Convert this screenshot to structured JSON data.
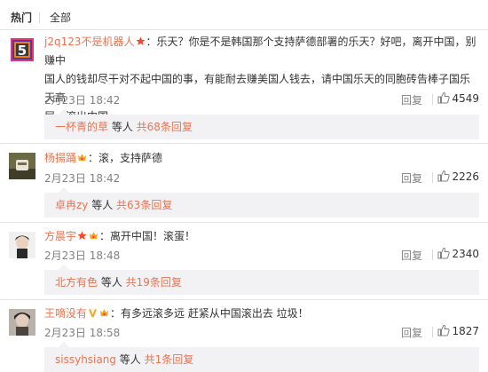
{
  "tabs": {
    "hot": "热门",
    "all": "全部"
  },
  "colors": {
    "username": "#eb7350",
    "text": "#333333",
    "meta": "#808080",
    "sub_bg": "#f2f2f5"
  },
  "comments": [
    {
      "user": "j2q123不是机器人",
      "badges": [
        "star-badge"
      ],
      "text_line1": "：乐天？你是不是韩国那个支持萨德部署的乐天？好吧，离开中国，别赚中",
      "text_line2": "国人的钱却尽干对不起中国的事，有能耐去赚美国人钱去，请中国乐天的同胞砖告棒子国乐天高",
      "text_line3": "层，滚出中国",
      "time": "2月23日 18:42",
      "reply": "回复",
      "likes": "4549",
      "sub_user": "一杯青的草",
      "sub_mid": " 等人 ",
      "sub_count": "共68条回复",
      "avatar_text": "5"
    },
    {
      "user": "杨揚踊",
      "badges": [
        "vip-badge"
      ],
      "text_line1": "：滚，支持萨德",
      "time": "2月23日 18:42",
      "reply": "回复",
      "likes": "2226",
      "sub_user": "卓冉zy",
      "sub_mid": " 等人 ",
      "sub_count": "共63条回复"
    },
    {
      "user": "方晨宇",
      "badges": [
        "star-badge",
        "vip-badge"
      ],
      "text_line1": "：离开中国！滚蛋！",
      "time": "2月23日 18:48",
      "reply": "回复",
      "likes": "2340",
      "sub_user": "北方有色",
      "sub_mid": " 等人 ",
      "sub_count": "共19条回复"
    },
    {
      "user": "王嘀没有",
      "badges": [
        "v-badge",
        "vip-badge"
      ],
      "text_line1": "：有多远滚多远 赶紧从中国滚出去 垃圾！",
      "time": "2月23日 18:58",
      "reply": "回复",
      "likes": "1827",
      "sub_user": "sissyhsiang",
      "sub_mid": " 等人 ",
      "sub_count": "共1条回复"
    }
  ]
}
